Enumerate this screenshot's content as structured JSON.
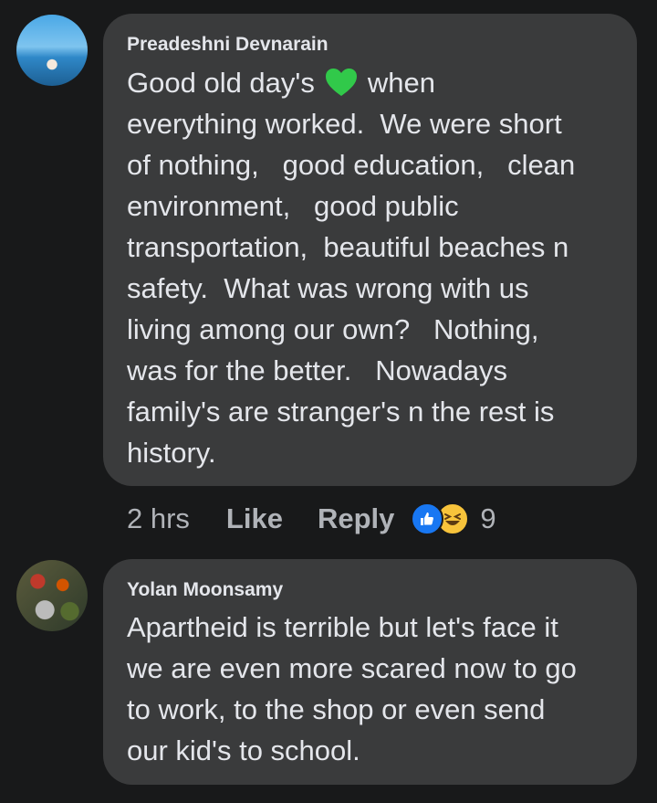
{
  "comments": [
    {
      "author": "Preadeshni Devnarain",
      "text_before": "Good old day's",
      "emoji": "green-heart-emoji",
      "text_after": "when\neverything worked.  We were short\nof nothing,   good education,   clean\nenvironment,   good public\ntransportation,  beautiful beaches n\nsafety.  What was wrong with us\nliving among our own?   Nothing,\nwas for the better.   Nowadays\nfamily's are stranger's n the rest is\nhistory.",
      "time": "2 hrs",
      "like_label": "Like",
      "reply_label": "Reply",
      "reaction_icons": [
        "like-reaction-icon",
        "haha-reaction-icon"
      ],
      "reaction_count": "9"
    },
    {
      "author": "Yolan Moonsamy",
      "text": "Apartheid is terrible but let's face it\nwe are even more scared now to go\nto work, to the shop or even send\nour kid's to school."
    }
  ],
  "colors": {
    "background": "#18191a",
    "bubble": "#3a3b3c",
    "text": "#e4e6eb",
    "muted": "#b0b3b8",
    "like_blue": "#1877f2",
    "haha_yellow": "#f7c33b",
    "heart_green": "#31c94a"
  }
}
